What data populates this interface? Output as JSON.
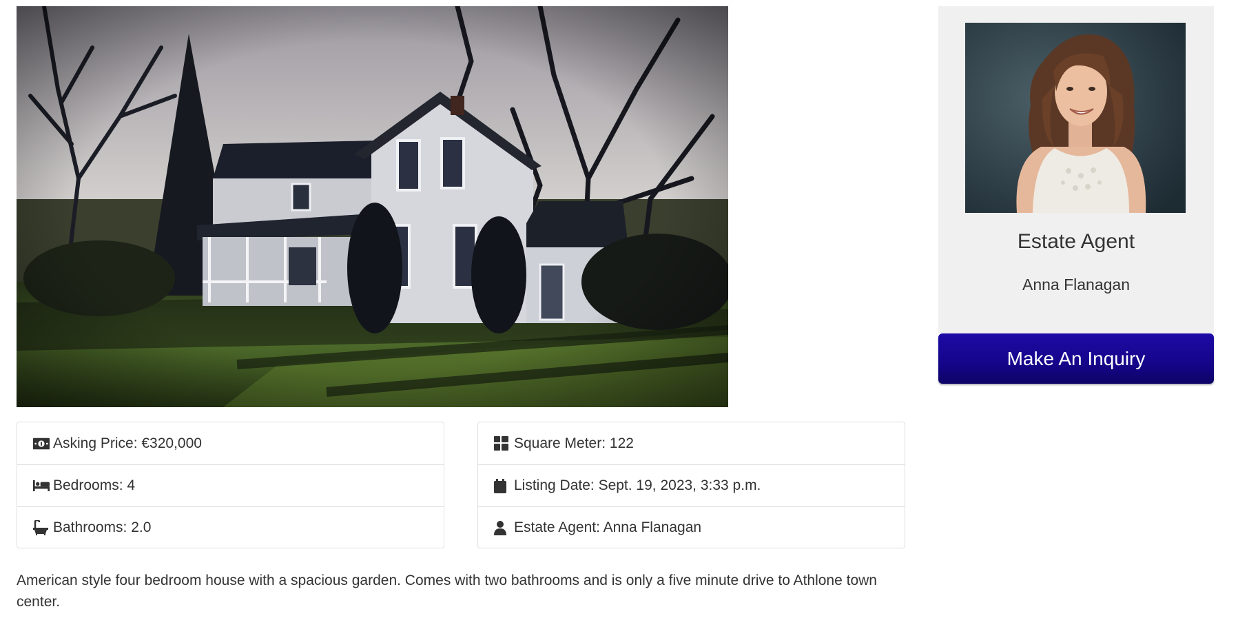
{
  "property": {
    "photo_alt": "White two-storey farmhouse with front porch, surrounded by bare trees and a green lawn",
    "details_left": [
      {
        "icon": "money-bill-icon",
        "label": "Asking Price: €320,000"
      },
      {
        "icon": "bed-icon",
        "label": "Bedrooms: 4"
      },
      {
        "icon": "bath-icon",
        "label": "Bathrooms: 2.0"
      }
    ],
    "details_right": [
      {
        "icon": "grid-icon",
        "label": "Square Meter: 122"
      },
      {
        "icon": "calendar-icon",
        "label": "Listing Date: Sept. 19, 2023, 3:33 p.m."
      },
      {
        "icon": "user-icon",
        "label": "Estate Agent: Anna Flanagan"
      }
    ],
    "description": "American style four bedroom house with a spacious garden. Comes with two bathrooms and is only a five minute drive to Athlone town center."
  },
  "agent": {
    "role": "Estate Agent",
    "name": "Anna Flanagan",
    "photo_alt": "Smiling woman with long wavy brown hair wearing a white lace top"
  },
  "inquiry_button": {
    "label": "Make An Inquiry"
  },
  "colors": {
    "button_primary": "#15058a",
    "panel_bg": "#f0f0f0",
    "border": "#dfdfdf",
    "text": "#333333"
  }
}
